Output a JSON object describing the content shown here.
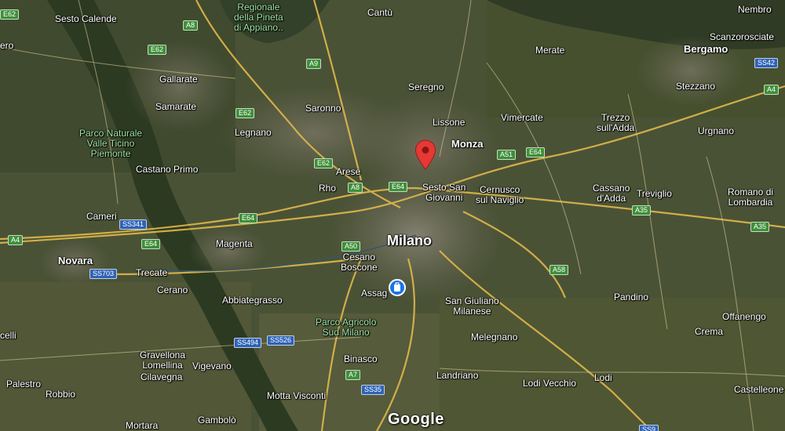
{
  "map": {
    "provider_logo": "Google",
    "pin_icon": "map-pin-icon",
    "pin_color": "#e53935",
    "airport_icon": "airport-icon",
    "airport_color": "#1a73e8",
    "labels": {
      "sesto_calende": "Sesto Calende",
      "cantu": "Cantù",
      "nembro": "Nembro",
      "pineta_1": "Regionale",
      "pineta_2": "della Pineta",
      "pineta_3": "di Appiano..",
      "merate": "Merate",
      "scanzorosciate": "Scanzorosciate",
      "bergamo": "Bergamo",
      "gallarate": "Gallarate",
      "seregno": "Seregno",
      "stezzano": "Stezzano",
      "samarate": "Samarate",
      "saronno": "Saronno",
      "lissone": "Lissone",
      "vimercate": "Vimercate",
      "trezzo_1": "Trezzo",
      "trezzo_2": "sull'Adda",
      "urgnano": "Urgnano",
      "ticino_1": "Parco Naturale",
      "ticino_2": "Valle Ticino",
      "ticino_3": "Piemonte",
      "legnano": "Legnano",
      "monza": "Monza",
      "castano_primo": "Castano Primo",
      "arese": "Arese",
      "sesto_sg_1": "Sesto San",
      "sesto_sg_2": "Giovanni",
      "cernusco_1": "Cernusco",
      "cernusco_2": "sul Naviglio",
      "cassano_1": "Cassano",
      "cassano_2": "d'Adda",
      "treviglio": "Treviglio",
      "romano_1": "Romano di",
      "romano_2": "Lombardia",
      "rho": "Rho",
      "cameri": "Cameri",
      "novara": "Novara",
      "magenta": "Magenta",
      "milano": "Milano",
      "cesano_1": "Cesano",
      "cesano_2": "Boscone",
      "trecate": "Trecate",
      "cerano": "Cerano",
      "abbiategrasso": "Abbiategrasso",
      "assago": "Assag",
      "san_giuliano_1": "San Giuliano",
      "san_giuliano_2": "Milanese",
      "pandino": "Pandino",
      "offanengo": "Offanengo",
      "sud_milano_1": "Parco Agricolo",
      "sud_milano_2": "Sud Milano",
      "vercelli": "celli",
      "melegnano": "Melegnano",
      "crema": "Crema",
      "gravellona_1": "Gravellona",
      "gravellona_2": "Lomellina",
      "binasco": "Binasco",
      "cilavegna": "Cilavegna",
      "vigevano": "Vigevano",
      "landriano": "Landriano",
      "lodi": "Lodi",
      "lodi_vecchio": "Lodi Vecchio",
      "palestro": "Palestro",
      "robbio": "Robbio",
      "motta": "Motta Visconti",
      "castelleone": "Castelleone",
      "gambolo": "Gambolò",
      "mortara": "Mortara",
      "ero": "ero"
    },
    "shields": {
      "e62_a": "E62",
      "a8_a": "A8",
      "e62_b": "E62",
      "a9": "A9",
      "e62_c": "E62",
      "ss42": "SS42",
      "a4_east": "A4",
      "a51": "A51",
      "e64_a": "E64",
      "e62_d": "E62",
      "a8_b": "A8",
      "e64_b": "E64",
      "ss341": "SS341",
      "e64_c": "E64",
      "a35_a": "A35",
      "a35_b": "A35",
      "a4_west": "A4",
      "e64_d": "E64",
      "a50": "A50",
      "ss703": "SS703",
      "a58": "A58",
      "ss494": "SS494",
      "ss526": "SS526",
      "a7": "A7",
      "ss35": "SS35",
      "ss9": "SS9"
    }
  }
}
